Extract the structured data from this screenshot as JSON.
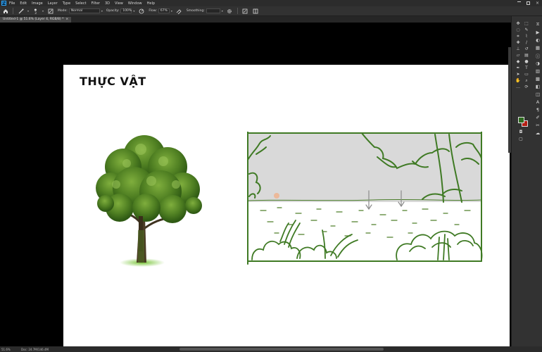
{
  "app": {
    "logo_text": "Ps"
  },
  "menu": [
    "File",
    "Edit",
    "Image",
    "Layer",
    "Type",
    "Select",
    "Filter",
    "3D",
    "View",
    "Window",
    "Help"
  ],
  "options": {
    "mode_label": "Mode:",
    "mode_value": "Normal",
    "opacity_label": "Opacity:",
    "opacity_value": "100%",
    "flow_label": "Flow:",
    "flow_value": "67%",
    "smoothing_label": "Smoothing:",
    "brush_size": "3"
  },
  "tab": {
    "title": "Untitled-1 @ 51.6% (Layer 4, RGB/8) *",
    "close": "×"
  },
  "document": {
    "heading": "THỰC VẬT"
  },
  "colors": {
    "foreground": "#2e6b1f",
    "background": "#b41e14",
    "sketch_stroke": "#3f7a24",
    "sky_fill": "#d9d9d9"
  },
  "status": {
    "zoom": "51.6%",
    "doc_size": "Doc: 24.7M/146.4M"
  },
  "tools": [
    "move-icon",
    "artboard-icon",
    "marquee-icon",
    "lasso-icon",
    "quick-select-icon",
    "crop-icon",
    "eyedropper-icon",
    "healing-icon",
    "brush-icon",
    "clone-stamp-icon",
    "history-brush-icon",
    "eraser-icon",
    "gradient-icon",
    "blur-icon",
    "dodge-icon",
    "pen-icon",
    "type-icon",
    "path-select-icon",
    "rectangle-icon",
    "hand-icon",
    "zoom-icon",
    "more-icon"
  ],
  "panels": [
    "history-icon",
    "actions-icon",
    "color-icon",
    "swatches-icon",
    "info-icon",
    "adjustments-icon",
    "libraries-icon",
    "styles-icon",
    "layers-icon",
    "channels-icon",
    "character-icon",
    "paragraph-icon",
    "brushes-icon",
    "comments-icon"
  ]
}
